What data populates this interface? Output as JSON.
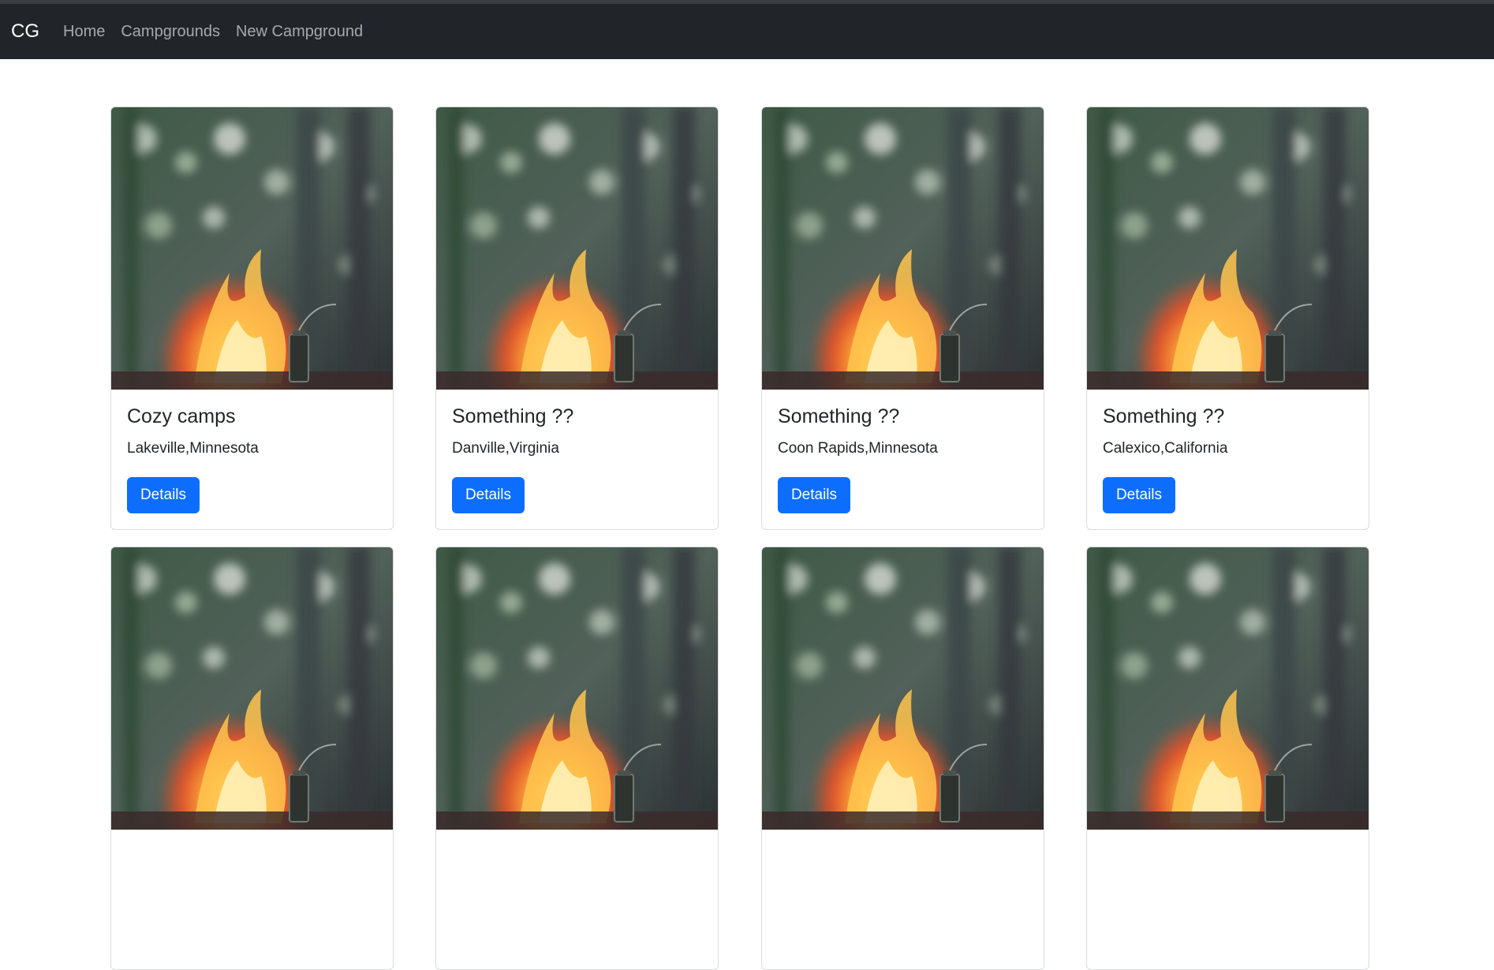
{
  "navbar": {
    "brand": "CG",
    "links": [
      "Home",
      "Campgrounds",
      "New Campground"
    ]
  },
  "campgrounds": [
    {
      "title": "Cozy camps",
      "location": "Lakeville,Minnesota",
      "button": "Details"
    },
    {
      "title": "Something ??",
      "location": "Danville,Virginia",
      "button": "Details"
    },
    {
      "title": "Something ??",
      "location": "Coon Rapids,Minnesota",
      "button": "Details"
    },
    {
      "title": "Something ??",
      "location": "Calexico,California",
      "button": "Details"
    },
    {
      "title": "",
      "location": "",
      "button": ""
    },
    {
      "title": "",
      "location": "",
      "button": ""
    },
    {
      "title": "",
      "location": "",
      "button": ""
    },
    {
      "title": "",
      "location": "",
      "button": ""
    }
  ],
  "colors": {
    "navbar": "#212529",
    "primary_button": "#0d6efd"
  }
}
